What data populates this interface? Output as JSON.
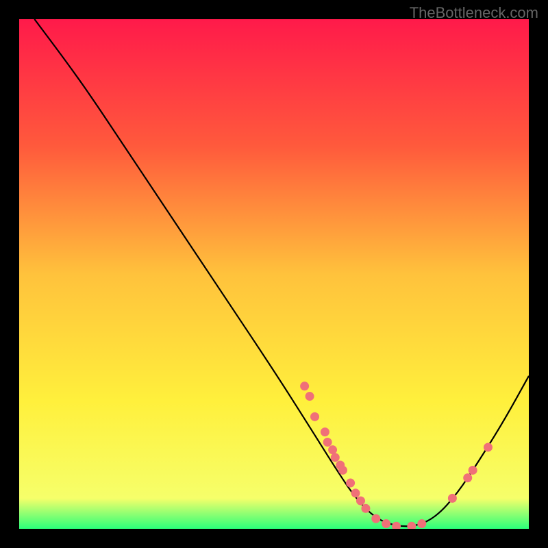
{
  "watermark": "TheBottleneck.com",
  "chart_data": {
    "type": "line",
    "title": "",
    "xlabel": "",
    "ylabel": "",
    "xlim": [
      0,
      100
    ],
    "ylim": [
      0,
      100
    ],
    "gradient_stops": [
      {
        "offset": 0,
        "color": "#ff1a4a"
      },
      {
        "offset": 25,
        "color": "#ff5a3c"
      },
      {
        "offset": 50,
        "color": "#ffc23c"
      },
      {
        "offset": 75,
        "color": "#fff03c"
      },
      {
        "offset": 94,
        "color": "#f6ff6a"
      },
      {
        "offset": 100,
        "color": "#2bff7a"
      }
    ],
    "curve": [
      {
        "x": 3,
        "y": 100
      },
      {
        "x": 9,
        "y": 92
      },
      {
        "x": 14,
        "y": 85
      },
      {
        "x": 20,
        "y": 76
      },
      {
        "x": 30,
        "y": 61
      },
      {
        "x": 40,
        "y": 46
      },
      {
        "x": 50,
        "y": 31
      },
      {
        "x": 57,
        "y": 20
      },
      {
        "x": 62,
        "y": 12
      },
      {
        "x": 66,
        "y": 6
      },
      {
        "x": 70,
        "y": 2
      },
      {
        "x": 74,
        "y": 0.5
      },
      {
        "x": 78,
        "y": 0.5
      },
      {
        "x": 82,
        "y": 2.5
      },
      {
        "x": 86,
        "y": 7
      },
      {
        "x": 90,
        "y": 13
      },
      {
        "x": 95,
        "y": 21
      },
      {
        "x": 100,
        "y": 30
      }
    ],
    "markers": [
      {
        "x": 56,
        "y": 28
      },
      {
        "x": 57,
        "y": 26
      },
      {
        "x": 58,
        "y": 22
      },
      {
        "x": 60,
        "y": 19
      },
      {
        "x": 60.5,
        "y": 17
      },
      {
        "x": 61.5,
        "y": 15.5
      },
      {
        "x": 62,
        "y": 14
      },
      {
        "x": 63,
        "y": 12.5
      },
      {
        "x": 63.5,
        "y": 11.5
      },
      {
        "x": 65,
        "y": 9
      },
      {
        "x": 66,
        "y": 7
      },
      {
        "x": 67,
        "y": 5.5
      },
      {
        "x": 68,
        "y": 4
      },
      {
        "x": 70,
        "y": 2
      },
      {
        "x": 72,
        "y": 1
      },
      {
        "x": 74,
        "y": 0.5
      },
      {
        "x": 77,
        "y": 0.5
      },
      {
        "x": 79,
        "y": 1
      },
      {
        "x": 85,
        "y": 6
      },
      {
        "x": 88,
        "y": 10
      },
      {
        "x": 89,
        "y": 11.5
      },
      {
        "x": 92,
        "y": 16
      }
    ],
    "marker_color": "#f07078",
    "curve_color": "#000000"
  }
}
